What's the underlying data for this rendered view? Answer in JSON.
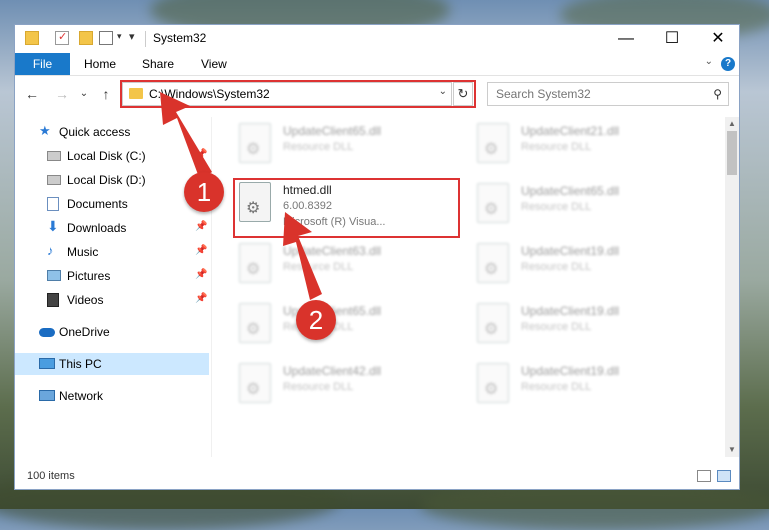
{
  "window": {
    "title": "System32",
    "controls": {
      "minimize": "—",
      "maximize": "☐",
      "close": "✕"
    }
  },
  "ribbon": {
    "file": "File",
    "tabs": [
      "Home",
      "Share",
      "View"
    ],
    "help": "?"
  },
  "navigation": {
    "back": "←",
    "forward": "→",
    "recent": "⌄",
    "up": "↑",
    "address": "C:\\Windows\\System32",
    "refresh": "↻",
    "search_placeholder": "Search System32"
  },
  "sidebar": {
    "items": [
      {
        "label": "Quick access",
        "icon": "star-icon"
      },
      {
        "label": "Local Disk (C:)",
        "icon": "drive-icon",
        "pinned": true
      },
      {
        "label": "Local Disk (D:)",
        "icon": "drive-icon"
      },
      {
        "label": "Documents",
        "icon": "documents-icon",
        "pinned": true
      },
      {
        "label": "Downloads",
        "icon": "download-icon",
        "pinned": true
      },
      {
        "label": "Music",
        "icon": "music-icon",
        "pinned": true
      },
      {
        "label": "Pictures",
        "icon": "pictures-icon",
        "pinned": true
      },
      {
        "label": "Videos",
        "icon": "videos-icon",
        "pinned": true
      },
      {
        "label": "OneDrive",
        "icon": "cloud-icon"
      },
      {
        "label": "This PC",
        "icon": "computer-icon",
        "selected": true
      },
      {
        "label": "Network",
        "icon": "network-icon"
      }
    ]
  },
  "files": {
    "highlighted": {
      "name": "htmed.dll",
      "version": "6.00.8392",
      "company": "Microsoft (R) Visua..."
    },
    "left_column": [
      {
        "name": "UpdateClient65.dll",
        "type": "Resource DLL"
      },
      {
        "name": "UpdateClient63.dll",
        "type": "Resource DLL"
      },
      {
        "name": "UpdateClient65.dll",
        "type": "Resource DLL"
      },
      {
        "name": "UpdateClient42.dll",
        "type": "Resource DLL"
      }
    ],
    "right_column": [
      {
        "name": "UpdateClient21.dll",
        "type": "Resource DLL"
      },
      {
        "name": "UpdateClient65.dll",
        "type": "Resource DLL"
      },
      {
        "name": "UpdateClient19.dll",
        "type": "Resource DLL"
      },
      {
        "name": "UpdateClient19.dll",
        "type": "Resource DLL"
      },
      {
        "name": "UpdateClient19.dll",
        "type": "Resource DLL"
      }
    ]
  },
  "status": {
    "item_count": "100 items"
  },
  "annotations": {
    "step1": "1",
    "step2": "2",
    "color": "#d9332b"
  }
}
